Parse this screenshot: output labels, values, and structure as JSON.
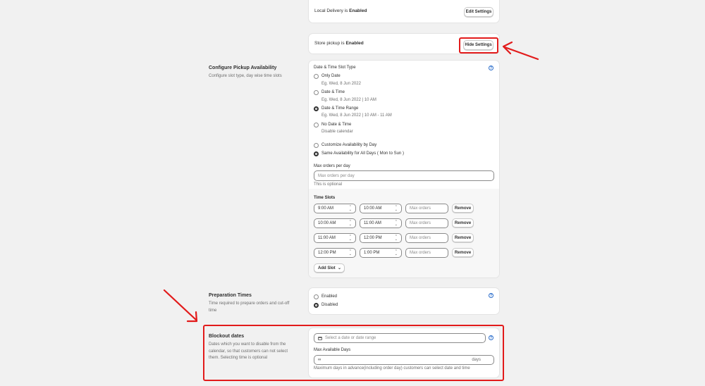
{
  "local_delivery": {
    "prefix": "Local Delivery is",
    "status": "Enabled",
    "button": "Edit Settings"
  },
  "store_pickup": {
    "prefix": "Store pickup is",
    "status": "Enabled",
    "button": "Hide Settings"
  },
  "configure": {
    "title": "Configure Pickup Availability",
    "desc": "Configure slot type, day wise time slots",
    "slot_type_label": "Date & Time Slot Type",
    "options": [
      {
        "label": "Only Date",
        "hint": "Eg. Wed, 8 Jun 2022"
      },
      {
        "label": "Date & Time",
        "hint": "Eg. Wed, 8 Jun 2022 | 10 AM"
      },
      {
        "label": "Date & Time Range",
        "hint": "Eg. Wed, 8 Jun 2022 | 10 AM - 11 AM"
      },
      {
        "label": "No Date & Time",
        "hint": "Disable calendar"
      }
    ],
    "selected_option": "Date & Time Range",
    "availability": [
      {
        "label": "Customize Availability by Day"
      },
      {
        "label": "Same Availability for All Days ( Mon to Sun )"
      }
    ],
    "selected_availability": "Same Availability for All Days ( Mon to Sun )",
    "max_orders_label": "Max orders per day",
    "max_orders_placeholder": "Max orders per day",
    "max_orders_hint": "This is optional",
    "time_slots_title": "Time Slots",
    "slots": [
      {
        "start": "9:00 AM",
        "end": "10:00 AM",
        "max_placeholder": "Max orders",
        "remove": "Remove"
      },
      {
        "start": "10:00 AM",
        "end": "11:00 AM",
        "max_placeholder": "Max orders",
        "remove": "Remove"
      },
      {
        "start": "11:00 AM",
        "end": "12:00 PM",
        "max_placeholder": "Max orders",
        "remove": "Remove"
      },
      {
        "start": "12:00 PM",
        "end": "1:00 PM",
        "max_placeholder": "Max orders",
        "remove": "Remove"
      }
    ],
    "add_slot": "Add Slot"
  },
  "preparation": {
    "title": "Preparation Times",
    "desc": "Time required to prepare orders and cut-off time",
    "options": [
      "Enabled",
      "Disabled"
    ],
    "selected": "Disabled"
  },
  "blockout": {
    "title": "Blockout dates",
    "desc": "Dates which you want to disable from the calendar, so that customers can not select them. Selecting time is optional",
    "date_placeholder": "Select a date or date range",
    "max_days_label": "Max Available Days",
    "max_days_value": "∞",
    "max_days_suffix": "days",
    "max_days_hint": "Maximum days in advance(including order day) customers can select date and time"
  },
  "help_icon": "?",
  "colors": {
    "annotation": "#e21b1b",
    "link": "#2c6ecb",
    "background": "#f1f1f1"
  }
}
